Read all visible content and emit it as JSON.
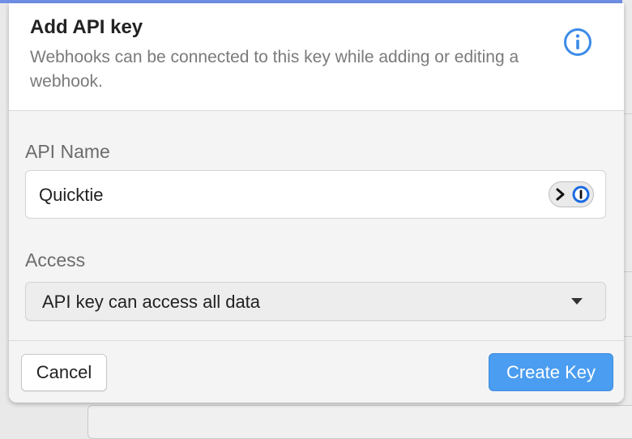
{
  "modal": {
    "title": "Add API key",
    "subtitle": "Webhooks can be connected to this key while adding or editing a webhook.",
    "info_icon": "info-circle-icon"
  },
  "form": {
    "name_label": "API Name",
    "name_value": "Quicktie",
    "password_manager_icon": "password-manager-icon",
    "access_label": "Access",
    "access_selected": "API key can access all data"
  },
  "footer": {
    "cancel_label": "Cancel",
    "create_label": "Create Key"
  },
  "colors": {
    "primary": "#4a9df0",
    "accent_bar": "#6f8fe6",
    "info_icon": "#3b8be8"
  }
}
